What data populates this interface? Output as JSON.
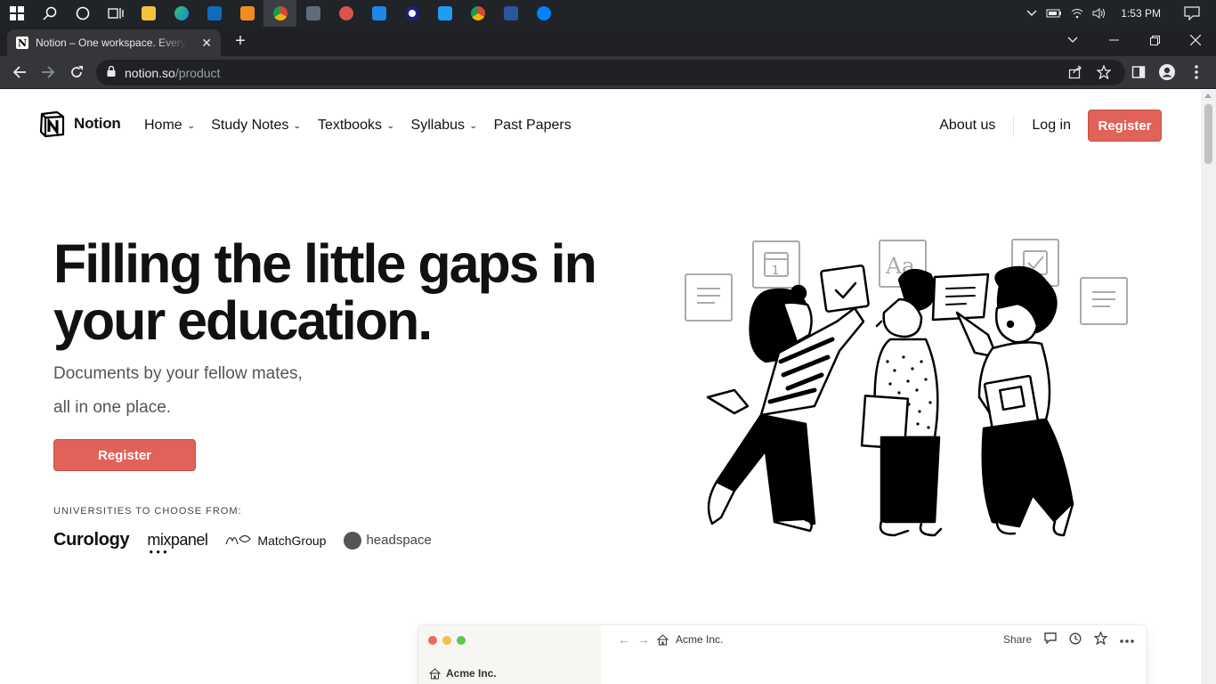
{
  "taskbar": {
    "icons": [
      "windows-icon",
      "search-icon",
      "cortana-icon",
      "task-view-icon",
      "file-explorer-icon",
      "edge-icon",
      "mail-icon",
      "media-player-icon",
      "chrome-icon",
      "calculator-icon",
      "paint-icon",
      "app-icon",
      "app-icon-2",
      "vscode-icon",
      "chrome-alt-icon",
      "word-icon",
      "messenger-icon"
    ],
    "clock": "1:53 PM"
  },
  "browser": {
    "tab_title": "Notion – One workspace. Every team.",
    "url_host": "notion.so",
    "url_path": "/product"
  },
  "nav": {
    "brand": "Notion",
    "items": [
      {
        "label": "Home",
        "dropdown": true
      },
      {
        "label": "Study Notes",
        "dropdown": true
      },
      {
        "label": "Textbooks",
        "dropdown": true
      },
      {
        "label": "Syllabus",
        "dropdown": true
      },
      {
        "label": "Past Papers",
        "dropdown": false
      }
    ],
    "about": "About us",
    "login": "Log in",
    "register": "Register"
  },
  "hero": {
    "title_line1": "Filling the little gaps in",
    "title_line2": "your education.",
    "subtitle_line1": "Documents by your fellow mates,",
    "subtitle_line2": "all in one place.",
    "cta": "Register",
    "universities_label": "UNIVERSITIES TO CHOOSE FROM:",
    "universities": [
      "Curology",
      "mixpanel",
      "MatchGroup",
      "headspace"
    ]
  },
  "demo": {
    "workspace": "Acme Inc.",
    "breadcrumb": "Acme Inc.",
    "share": "Share"
  },
  "colors": {
    "accent": "#e16259",
    "taskbar": "#202327",
    "chrome_dark": "#35363a"
  }
}
